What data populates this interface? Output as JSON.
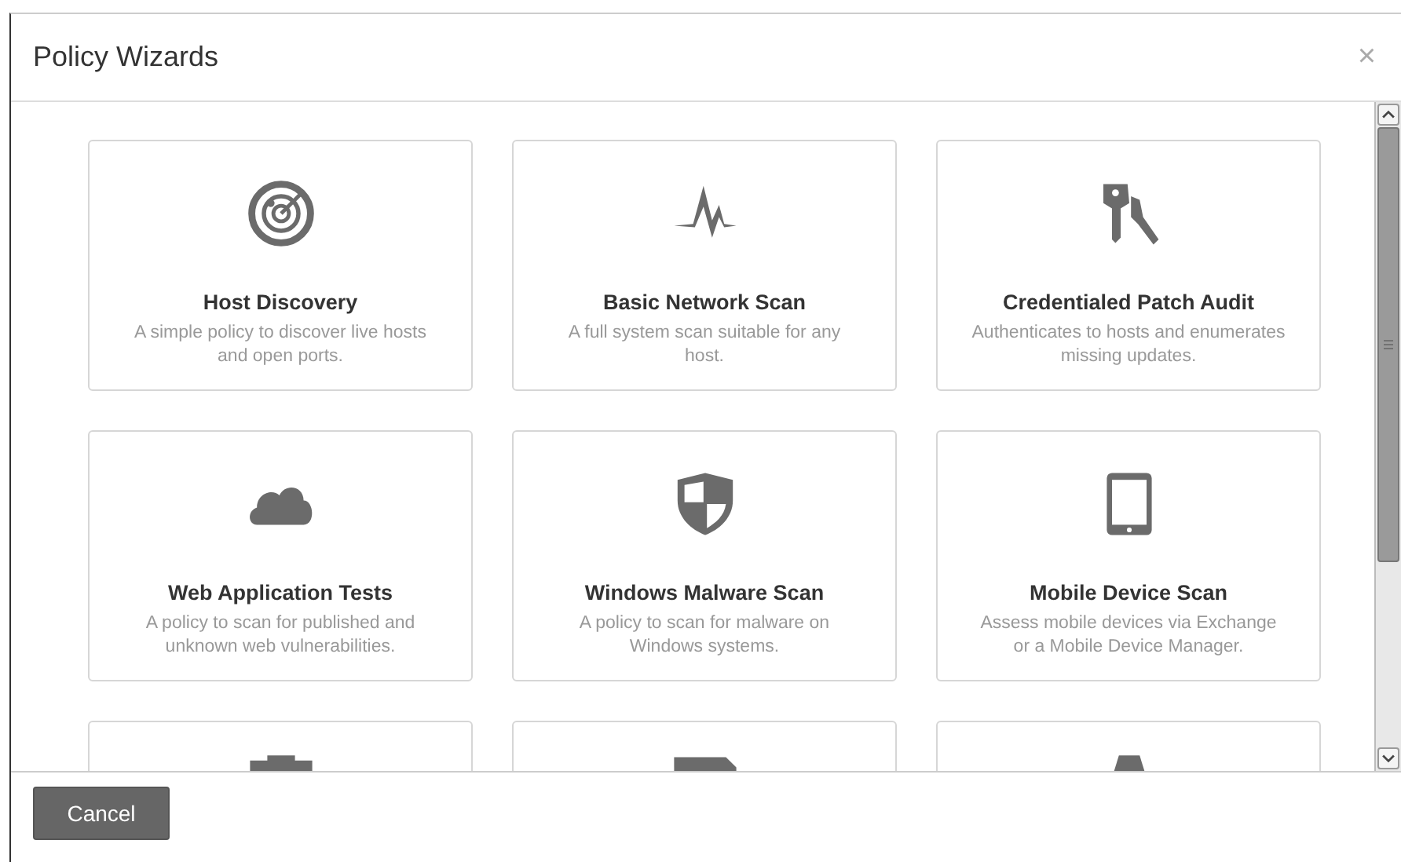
{
  "dialog": {
    "title": "Policy Wizards",
    "close": "×"
  },
  "wizards": [
    {
      "kind": "full",
      "title": "Host Discovery",
      "description": "A simple policy to discover live hosts and open ports."
    },
    {
      "kind": "full",
      "title": "Basic Network Scan",
      "description": "A full system scan suitable for any host."
    },
    {
      "kind": "full",
      "title": "Credentialed Patch Audit",
      "description": "Authenticates to hosts and enumerates missing updates."
    },
    {
      "kind": "full",
      "title": "Web Application Tests",
      "description": "A policy to scan for published and unknown web vulnerabilities."
    },
    {
      "kind": "full",
      "title": "Windows Malware Scan",
      "description": "A policy to scan for malware on Windows systems."
    },
    {
      "kind": "full",
      "title": "Mobile Device Scan",
      "description": "Assess mobile devices via Exchange or a Mobile Device Manager."
    },
    {
      "kind": "partial"
    },
    {
      "kind": "partial"
    },
    {
      "kind": "partial"
    }
  ],
  "footer": {
    "buttons": [
      "Cancel"
    ]
  }
}
